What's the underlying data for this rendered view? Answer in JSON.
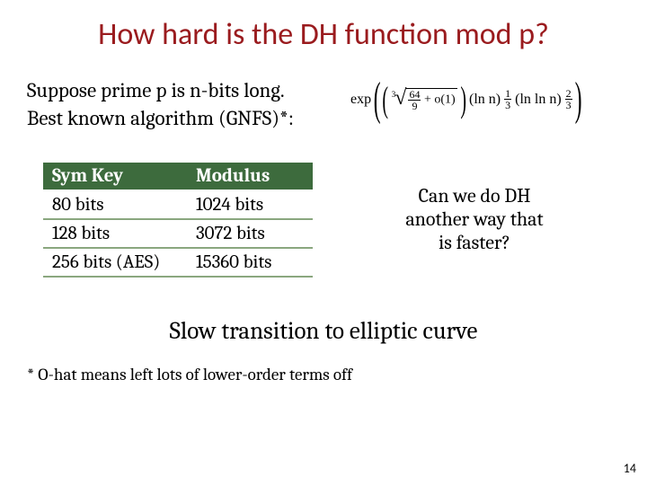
{
  "title": "How hard is the DH function mod p?",
  "intro_line1": "Suppose prime p is n-bits long.",
  "intro_line2": "Best known algorithm (GNFS)*:",
  "formula": {
    "exp": "exp",
    "cbrt_index": "3",
    "frac_num": "64",
    "frac_den": "9",
    "o1": " + o(1)",
    "ln_n": "(ln n)",
    "exp1_num": "1",
    "exp1_den": "3",
    "lnln_n": "(ln ln n)",
    "exp2_num": "2",
    "exp2_den": "3"
  },
  "table": {
    "headers": [
      "Sym Key",
      "Modulus"
    ],
    "rows": [
      [
        "80 bits",
        "1024 bits"
      ],
      [
        "128 bits",
        "3072 bits"
      ],
      [
        "256 bits (AES)",
        "15360 bits"
      ]
    ]
  },
  "aside_l1": "Can we do DH",
  "aside_l2": "another way that",
  "aside_l3": "is faster?",
  "transition": "Slow transition to elliptic curve",
  "footnote": "* O-hat means left lots of lower-order terms off",
  "pagenum": "14"
}
